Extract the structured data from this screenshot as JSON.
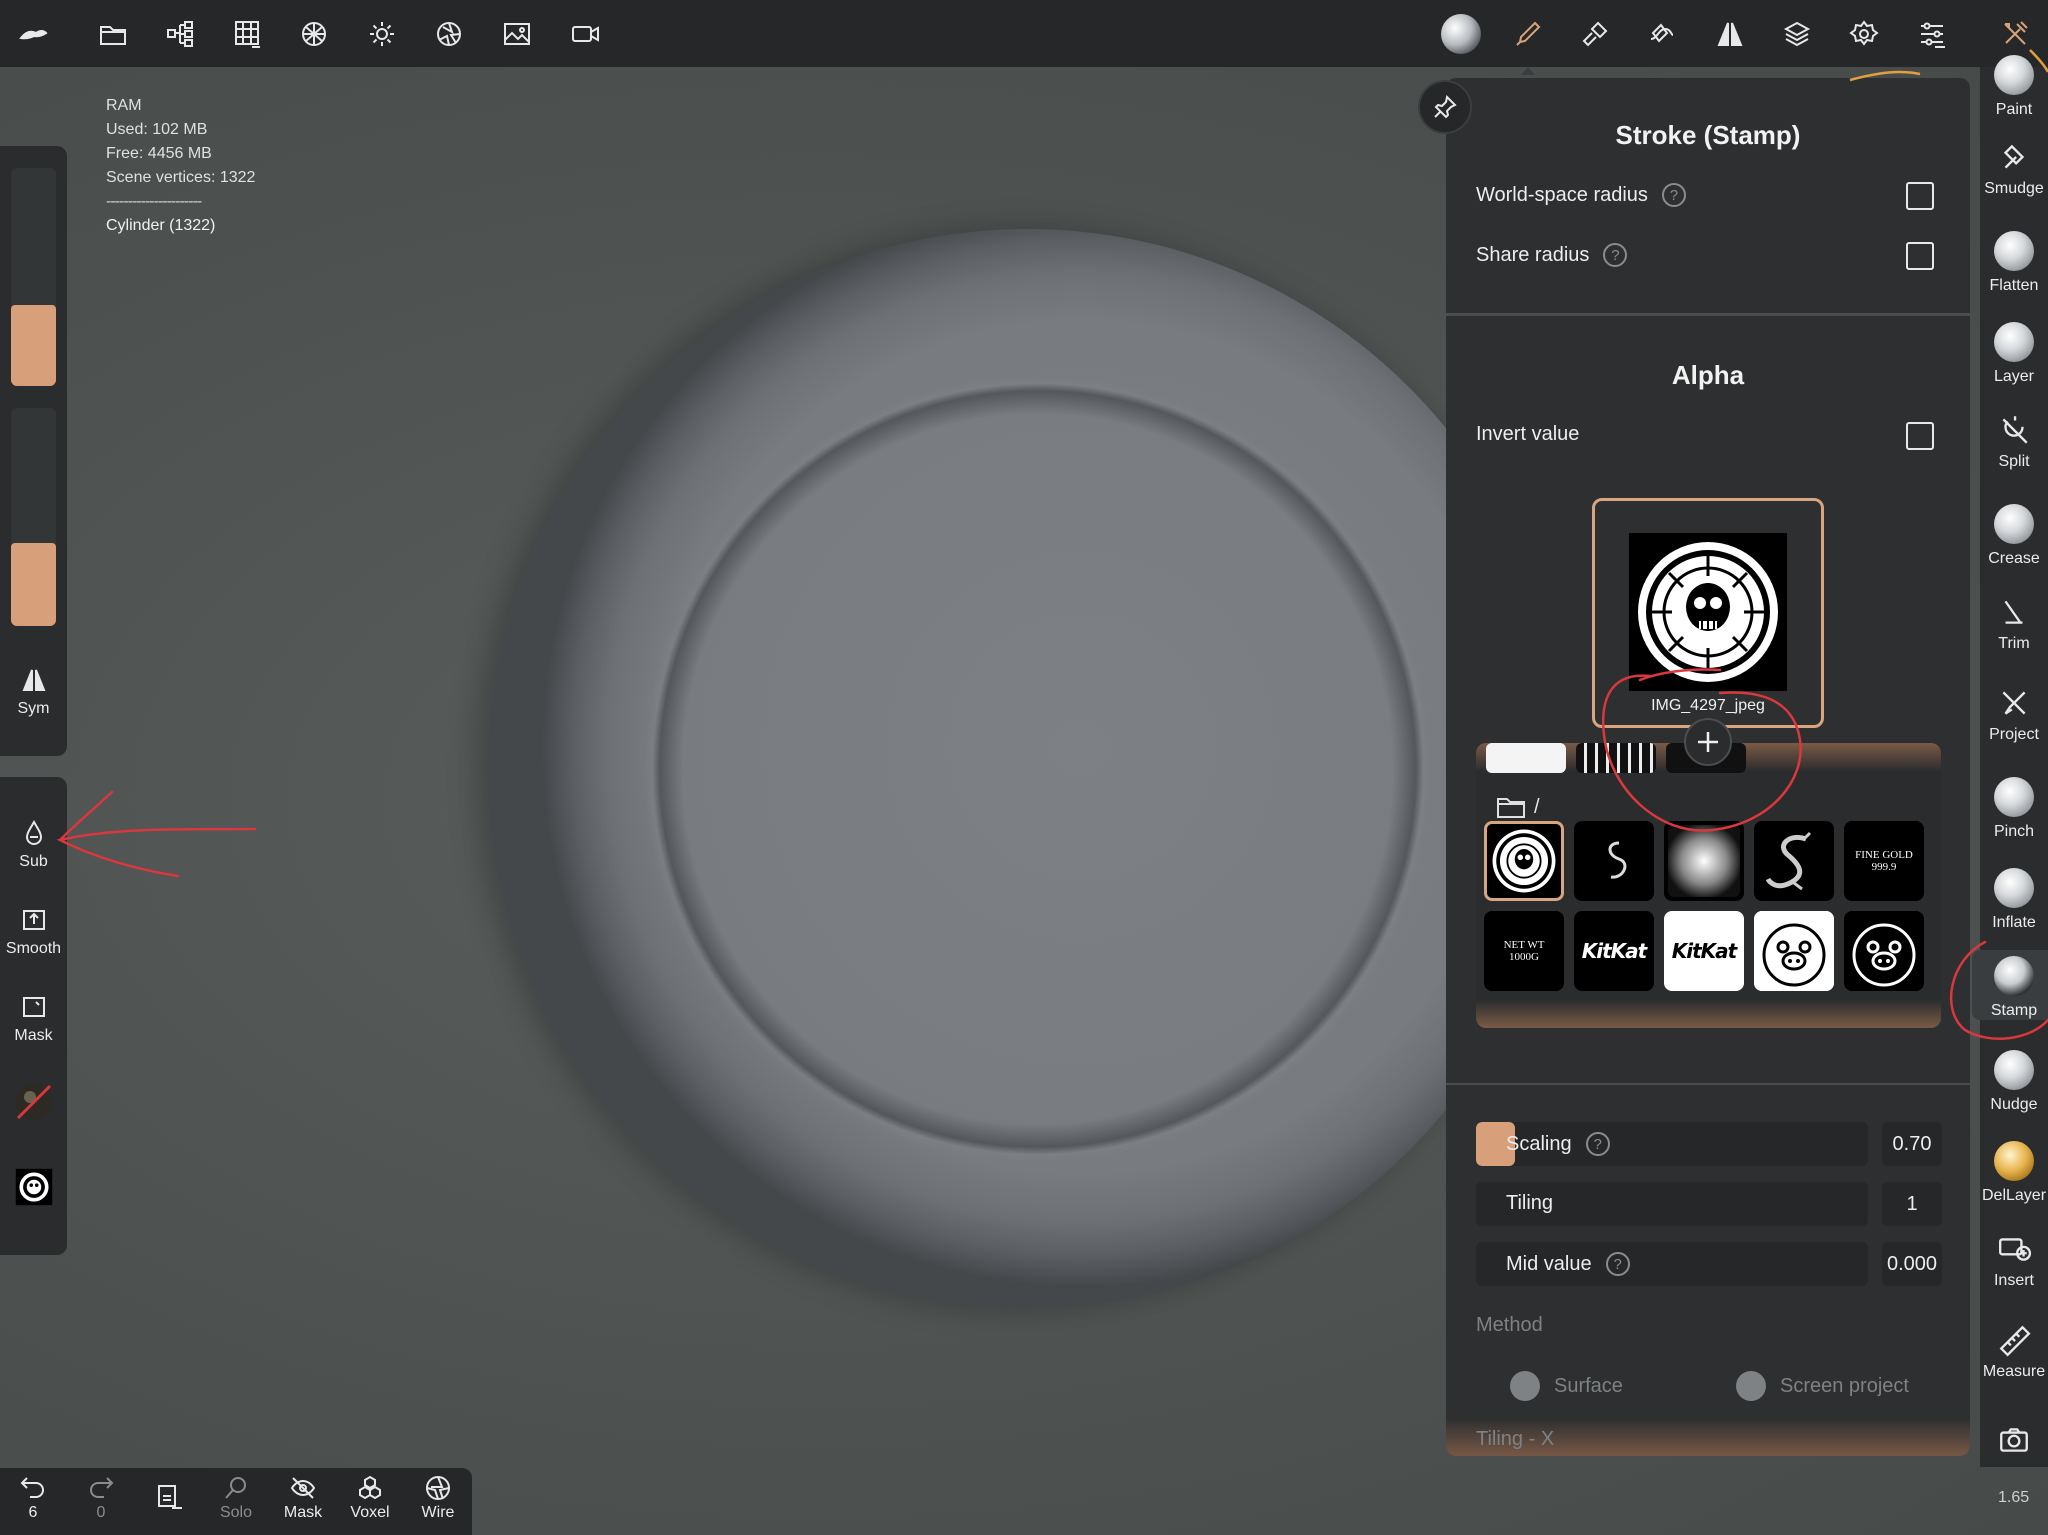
{
  "stats": {
    "ram_label": "RAM",
    "used": "Used: 102 MB",
    "free": "Free: 4456 MB",
    "vertices": "Scene vertices: 1322",
    "separator": "----------------------",
    "object": "Cylinder (1322)"
  },
  "topbar": {
    "icons": [
      "nomad-logo-icon",
      "folder-icon",
      "scene-tree-icon",
      "grid-icon",
      "mesh-icon",
      "light-icon",
      "shading-icon",
      "image-icon",
      "camera-icon",
      "matcap-icon",
      "brush-icon",
      "tool-settings-icon",
      "stroke-icon",
      "symmetry-icon",
      "layers-icon",
      "gear-icon",
      "sliders-icon",
      "tools-icon"
    ]
  },
  "left": {
    "radius_value": 0.37,
    "intensity_value": 0.38,
    "sym_label": "Sym",
    "sub_label": "Sub",
    "smooth_label": "Smooth",
    "mask_label": "Mask"
  },
  "bottombar": {
    "undo_count": "6",
    "redo_count": "0",
    "solo_label": "Solo",
    "mask_label": "Mask",
    "voxel_label": "Voxel",
    "wire_label": "Wire"
  },
  "tools": [
    "Paint",
    "Smudge",
    "Flatten",
    "Layer",
    "Split",
    "Crease",
    "Trim",
    "Project",
    "Pinch",
    "Inflate",
    "Stamp",
    "Nudge",
    "DelLayer",
    "Insert",
    "Measure"
  ],
  "selected_tool": "Stamp",
  "zoom": "1.65",
  "panel": {
    "stroke_title": "Stroke (Stamp)",
    "world_space_radius": "World-space radius",
    "share_radius": "Share radius",
    "alpha_title": "Alpha",
    "invert_value": "Invert value",
    "alpha_filename": "IMG_4297_jpeg",
    "library_path": "/",
    "thumbs": [
      {
        "kind": "skull-coin",
        "text": ""
      },
      {
        "kind": "squiggle",
        "text": ""
      },
      {
        "kind": "radial",
        "text": ""
      },
      {
        "kind": "dragon-s",
        "text": ""
      },
      {
        "kind": "fine-gold",
        "text": "FINE GOLD 999.9"
      },
      {
        "kind": "net-wt",
        "text": "NET WT 1000G"
      },
      {
        "kind": "kitkat-dark",
        "text": "KitKat"
      },
      {
        "kind": "kitkat-white",
        "text": "KitKat"
      },
      {
        "kind": "pig-white",
        "text": ""
      },
      {
        "kind": "pig-dark",
        "text": ""
      }
    ],
    "scaling_label": "Scaling",
    "scaling_value": "0.70",
    "scaling_fill": 0.1,
    "tiling_label": "Tiling",
    "tiling_value": "1",
    "mid_value_label": "Mid value",
    "mid_value_value": "0.000",
    "method_label": "Method",
    "surface_label": "Surface",
    "screen_project_label": "Screen project",
    "tiling_x_label": "Tiling - X",
    "help_glyph": "?"
  },
  "colors": {
    "accent": "#d7a07b",
    "panel_bg": "#2d2f30",
    "toolbar_bg": "#252728",
    "annotation": "#d8383e"
  }
}
